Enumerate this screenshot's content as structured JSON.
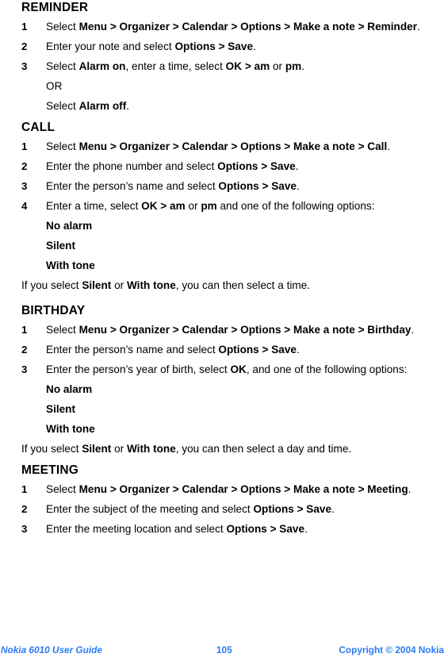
{
  "document": {
    "page_number": "105",
    "footer_left": "Nokia 6010 User Guide",
    "footer_right": "Copyright © 2004 Nokia",
    "footer_color": "#2d7bf4"
  },
  "sections": {
    "reminder": {
      "heading": "REMINDER",
      "steps": [
        {
          "num": "1",
          "parts": [
            "Select ",
            "Menu > Organizer > Calendar > Options > Make a note > Reminder",
            "."
          ]
        },
        {
          "num": "2",
          "parts": [
            "Enter your note and select ",
            "Options > Save",
            "."
          ]
        },
        {
          "num": "3",
          "parts": [
            "Select ",
            "Alarm on",
            ", enter a time, select ",
            "OK > am",
            " or ",
            "pm",
            "."
          ]
        }
      ],
      "sub_lines": [
        {
          "parts": [
            "OR"
          ]
        },
        {
          "parts": [
            "Select ",
            "Alarm off",
            "."
          ]
        }
      ]
    },
    "call": {
      "heading": "CALL",
      "steps": [
        {
          "num": "1",
          "parts": [
            "Select ",
            "Menu > Organizer > Calendar > Options > Make a note > Call",
            "."
          ]
        },
        {
          "num": "2",
          "parts": [
            "Enter the phone number and select ",
            "Options > Save",
            "."
          ]
        },
        {
          "num": "3",
          "parts": [
            "Enter the person’s name and select ",
            "Options > Save",
            "."
          ]
        },
        {
          "num": "4",
          "parts": [
            "Enter a time, select ",
            "OK > am",
            " or ",
            "pm",
            " and one of the following options:"
          ]
        }
      ],
      "options": [
        "No alarm",
        "Silent",
        "With tone"
      ],
      "note": {
        "parts": [
          "If you select ",
          "Silent",
          " or ",
          "With tone",
          ", you can then select a time."
        ]
      }
    },
    "birthday": {
      "heading": "BIRTHDAY",
      "steps": [
        {
          "num": "1",
          "parts": [
            "Select ",
            "Menu > Organizer > Calendar > Options > Make a note > Birthday",
            "."
          ]
        },
        {
          "num": "2",
          "parts": [
            "Enter the person’s name and select ",
            "Options > Save",
            "."
          ]
        },
        {
          "num": "3",
          "parts": [
            "Enter the person’s year of birth, select ",
            "OK",
            ", and one of the following options:"
          ]
        }
      ],
      "options": [
        "No alarm",
        "Silent",
        "With tone"
      ],
      "note": {
        "parts": [
          "If you select ",
          "Silent",
          " or ",
          "With tone",
          ", you can then select a day and time."
        ]
      }
    },
    "meeting": {
      "heading": "MEETING",
      "steps": [
        {
          "num": "1",
          "parts": [
            "Select ",
            "Menu > Organizer > Calendar > Options > Make a note > Meeting",
            "."
          ]
        },
        {
          "num": "2",
          "parts": [
            "Enter the subject of the meeting and select ",
            "Options > Save",
            "."
          ]
        },
        {
          "num": "3",
          "parts": [
            "Enter the meeting location and select ",
            "Options > Save",
            "."
          ]
        }
      ]
    }
  }
}
